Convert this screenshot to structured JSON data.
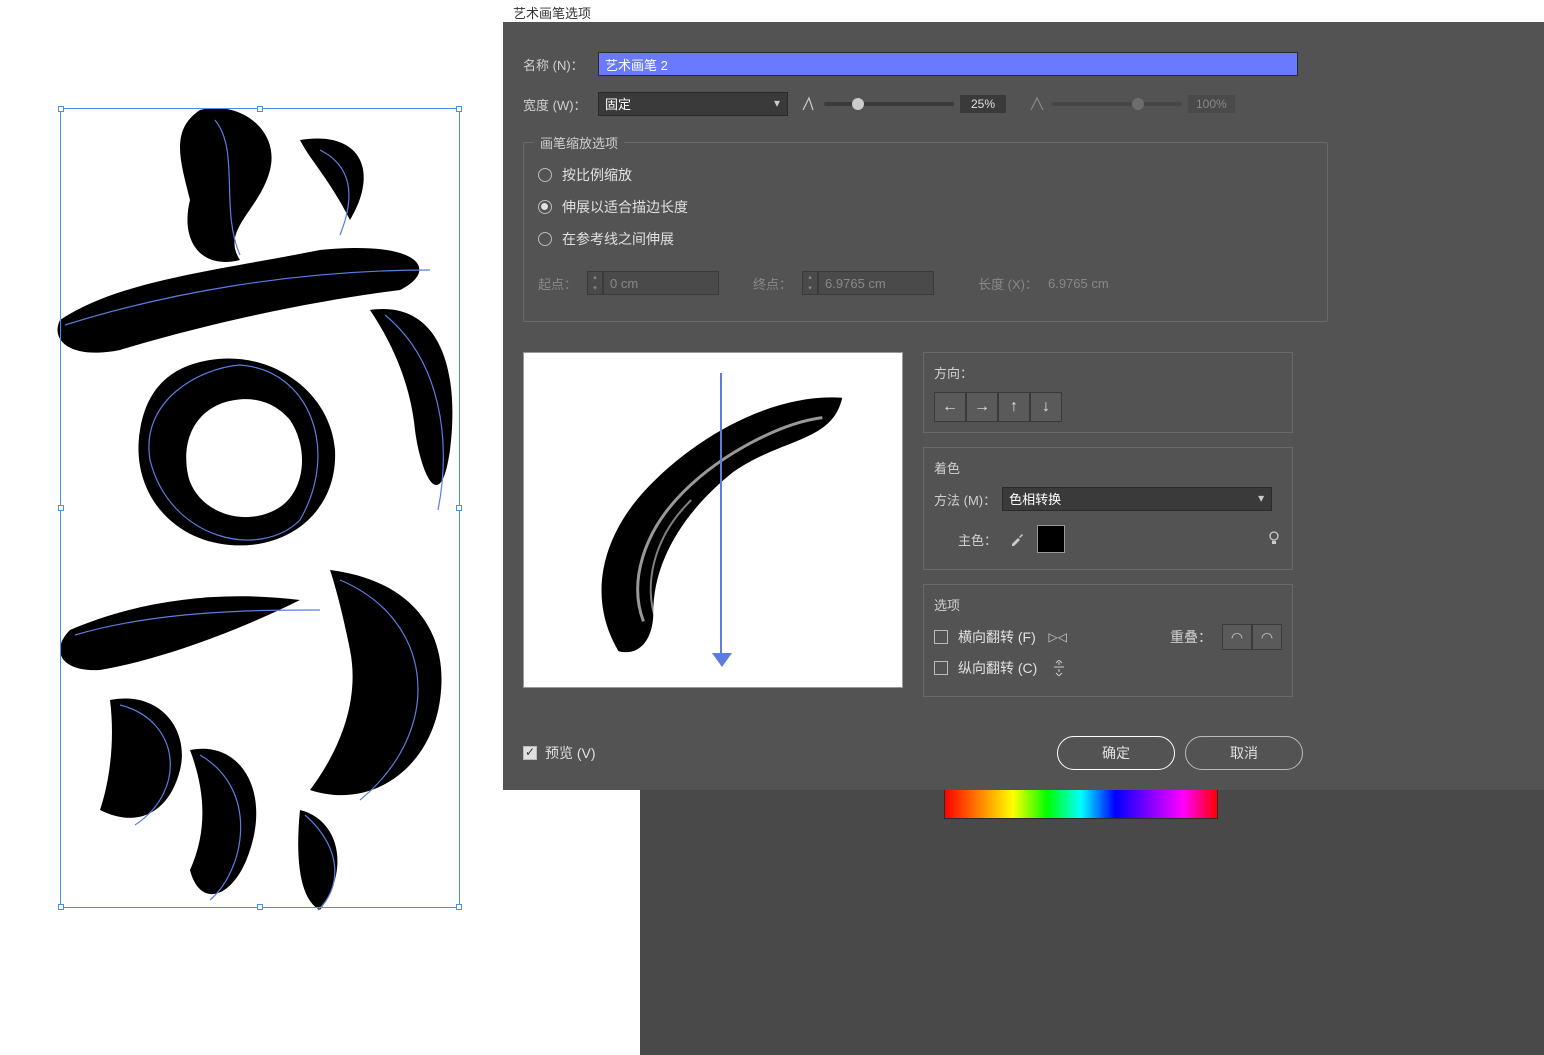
{
  "dialog": {
    "title": "艺术画笔选项",
    "name_label": "名称 (N)：",
    "name_value": "艺术画笔 2",
    "width_label": "宽度 (W)：",
    "width_mode": "固定",
    "width_pct1": "25%",
    "width_pct2": "100%"
  },
  "scale": {
    "group_title": "画笔缩放选项",
    "opt_proportional": "按比例缩放",
    "opt_stretch": "伸展以适合描边长度",
    "opt_guides": "在参考线之间伸展",
    "start_label": "起点：",
    "start_value": "0 cm",
    "end_label": "终点：",
    "end_value": "6.9765 cm",
    "length_label": "长度 (X)：",
    "length_value": "6.9765 cm"
  },
  "direction": {
    "title": "方向："
  },
  "coloration": {
    "title": "着色",
    "method_label": "方法 (M)：",
    "method_value": "色相转换",
    "keycolor_label": "主色："
  },
  "options": {
    "title": "选项",
    "flip_h": "横向翻转 (F)",
    "flip_v": "纵向翻转 (C)",
    "overlap_label": "重叠："
  },
  "footer": {
    "preview": "预览 (V)",
    "ok": "确定",
    "cancel": "取消"
  }
}
